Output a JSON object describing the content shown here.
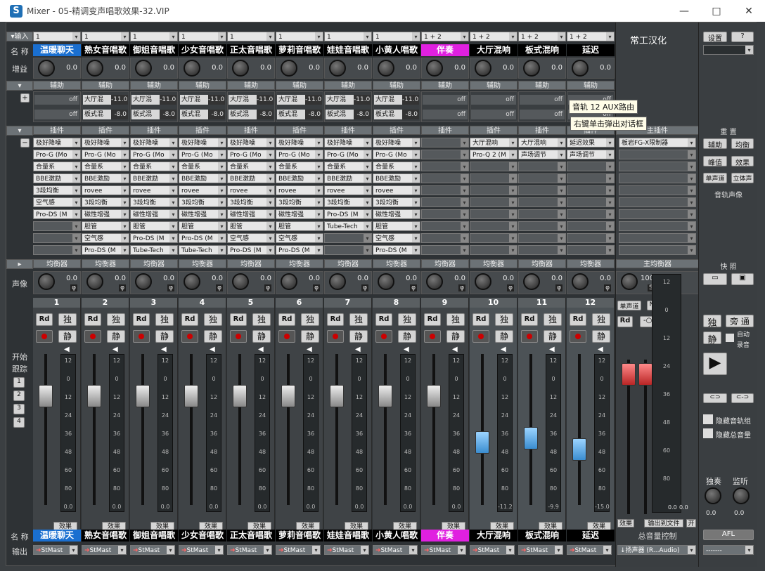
{
  "window": {
    "title": "Mixer - 05-精调变声唱歌效果-32.VIP",
    "icon_letter": "S"
  },
  "labels": {
    "input": "▾输入",
    "name": "名 称",
    "gain": "增益",
    "aux": "辅助",
    "plugin": "插件",
    "eq": "均衡器",
    "pan": "声像",
    "start": "开始",
    "follow": "跟踪",
    "name_bottom": "名 称",
    "output": "输出",
    "main_plugin": "主插件",
    "main_eq": "主均衡器",
    "reset": "重 置",
    "snapshot": "快 照",
    "track_pan": "音轨声像",
    "master_ctrl": "总音量控制",
    "hide_groups": "隐藏音轨组",
    "hide_master": "隐藏总音量",
    "solo": "独奏",
    "monitor": "监听",
    "afl": "AFL",
    "mono": "单声道",
    "n": "N",
    "output_to_file": "输出到文件",
    "open": "开",
    "auto": "自动",
    "record": "录音",
    "bypass": "旁 通",
    "solo_short": "独",
    "mute": "静",
    "rd": "Rd",
    "effect": "效果",
    "chinese": "常工汉化",
    "settings": "设置",
    "help": "?"
  },
  "follow_buttons": [
    "1",
    "2",
    "3",
    "4"
  ],
  "channels": [
    {
      "num": "1",
      "input": "1",
      "name": "温暖聊天",
      "color": "#1a6fd0",
      "gain": "0.0",
      "aux1": "off",
      "aux2": "off",
      "plugins": [
        "极好降噪",
        "Pro-G (Mo",
        "合量系",
        "BBE激励",
        "3段均衡",
        "空气感",
        "Pro-DS (M",
        "",
        "",
        ""
      ],
      "pan": "0.0",
      "meter": "0.0",
      "fader": 0.78,
      "cap": "gray"
    },
    {
      "num": "2",
      "input": "1",
      "name": "熟女音唱歌",
      "color": "#000000",
      "gain": "0.0",
      "aux1": "大厅混 -11.0",
      "aux2": "板式混 -8.0",
      "plugins": [
        "极好降噪",
        "Pro-G (Mo",
        "合量系",
        "BBE激励",
        "rovee",
        "3段均衡",
        "磁性增强",
        "胆管",
        "空气感",
        "Pro-DS (M"
      ],
      "pan": "0.0",
      "meter": "0.0",
      "fader": 0.78,
      "cap": "gray"
    },
    {
      "num": "3",
      "input": "1",
      "name": "御姐音唱歌",
      "color": "#000000",
      "gain": "0.0",
      "aux1": "大厅混 -11.0",
      "aux2": "板式混 -8.0",
      "plugins": [
        "极好降噪",
        "Pro-G (Mo",
        "合量系",
        "BBE激励",
        "rovee",
        "3段均衡",
        "磁性增强",
        "胆管",
        "Pro-DS (M",
        "Tube-Tech"
      ],
      "pan": "0.0",
      "meter": "0.0",
      "fader": 0.78,
      "cap": "gray"
    },
    {
      "num": "4",
      "input": "1",
      "name": "少女音唱歌",
      "color": "#000000",
      "gain": "0.0",
      "aux1": "大厅混 -11.0",
      "aux2": "板式混 -8.0",
      "plugins": [
        "极好降噪",
        "Pro-G (Mo",
        "合量系",
        "BBE激励",
        "rovee",
        "3段均衡",
        "磁性增强",
        "胆管",
        "Pro-DS (M",
        "Tube-Tech"
      ],
      "pan": "0.0",
      "meter": "0.0",
      "fader": 0.78,
      "cap": "gray"
    },
    {
      "num": "5",
      "input": "1",
      "name": "正太音唱歌",
      "color": "#000000",
      "gain": "0.0",
      "aux1": "大厅混 -11.0",
      "aux2": "板式混 -8.0",
      "plugins": [
        "极好降噪",
        "Pro-G (Mo",
        "合量系",
        "BBE激励",
        "rovee",
        "3段均衡",
        "磁性增强",
        "胆管",
        "空气感",
        "Pro-DS (M"
      ],
      "pan": "0.0",
      "meter": "0.0",
      "fader": 0.78,
      "cap": "gray"
    },
    {
      "num": "6",
      "input": "1",
      "name": "萝莉音唱歌",
      "color": "#000000",
      "gain": "0.0",
      "aux1": "大厅混 -11.0",
      "aux2": "板式混 -8.0",
      "plugins": [
        "极好降噪",
        "Pro-G (Mo",
        "合量系",
        "BBE激励",
        "rovee",
        "3段均衡",
        "磁性增强",
        "胆管",
        "空气感",
        "Pro-DS (M"
      ],
      "pan": "0.0",
      "meter": "0.0",
      "fader": 0.78,
      "cap": "gray"
    },
    {
      "num": "7",
      "input": "1",
      "name": "娃娃音唱歌",
      "color": "#000000",
      "gain": "0.0",
      "aux1": "大厅混 -11.0",
      "aux2": "板式混 -8.0",
      "plugins": [
        "极好降噪",
        "Pro-G (Mo",
        "合量系",
        "BBE激励",
        "rovee",
        "3段均衡",
        "Pro-DS (M",
        "Tube-Tech",
        "",
        ""
      ],
      "pan": "0.0",
      "meter": "0.0",
      "fader": 0.78,
      "cap": "gray"
    },
    {
      "num": "8",
      "input": "1",
      "name": "小黄人唱歌",
      "color": "#000000",
      "gain": "0.0",
      "aux1": "大厅混 -11.0",
      "aux2": "板式混 -8.0",
      "plugins": [
        "极好降噪",
        "Pro-G (Mo",
        "合量系",
        "BBE激励",
        "rovee",
        "3段均衡",
        "磁性增强",
        "胆管",
        "空气感",
        "Pro-DS (M"
      ],
      "pan": "0.0",
      "meter": "0.0",
      "fader": 0.78,
      "cap": "gray"
    },
    {
      "num": "9",
      "input": "1 + 2",
      "name": "伴奏",
      "color": "#e020e0",
      "gain": "0.0",
      "aux1": "off",
      "aux2": "off",
      "plugins": [
        "",
        "",
        "",
        "",
        "",
        "",
        "",
        "",
        "",
        ""
      ],
      "pan": "0.0",
      "meter": "0.0",
      "fader": 0.78,
      "cap": "gray"
    },
    {
      "num": "10",
      "input": "1 + 2",
      "name": "大厅混响",
      "color": "#000000",
      "gain": "0.0",
      "aux1": "off",
      "aux2": "off",
      "plugins": [
        "大厅混响",
        "Pro-Q 2 (M",
        "",
        "",
        "",
        "",
        "",
        "",
        "",
        ""
      ],
      "pan": "0.0",
      "meter": "-11.2",
      "fader": 0.45,
      "cap": "blue"
    },
    {
      "num": "11",
      "input": "1 + 2",
      "name": "板式混响",
      "color": "#000000",
      "gain": "0.0",
      "aux1": "off",
      "aux2": "off",
      "plugins": [
        "大厅混响",
        "声场调节",
        "",
        "",
        "",
        "",
        "",
        "",
        "",
        ""
      ],
      "pan": "0.0",
      "meter": "-9.9",
      "fader": 0.48,
      "cap": "blue"
    },
    {
      "num": "12",
      "input": "1 + 2",
      "name": "延迟",
      "color": "#000000",
      "gain": "0.0",
      "aux1": "off",
      "aux2": "off",
      "plugins": [
        "延迟效果",
        "声场调节",
        "",
        "",
        "",
        "",
        "",
        "",
        "",
        ""
      ],
      "pan": "0.0",
      "meter": "-15.0",
      "fader": 0.4,
      "cap": "blue"
    }
  ],
  "output_target": "StMast",
  "master": {
    "plugin": "板岩FG-X限制器",
    "pan": "100",
    "pan_suffix": "SE",
    "meter_left": "0.0",
    "meter_right": "0.0",
    "output": "扬声器 (R...Audio)",
    "output_prefix": "↓",
    "out2": "-------"
  },
  "meter_scale": [
    "12",
    "0",
    "12",
    "24",
    "36",
    "48",
    "60",
    "80"
  ],
  "master_scale": [
    "12",
    "0",
    "12",
    "24",
    "36",
    "48",
    "60",
    "80"
  ],
  "right_buttons": {
    "aux": "辅助",
    "eq": "均衡",
    "peak": "峰值",
    "effect": "效果",
    "mono": "单声道",
    "stereo": "立体声"
  },
  "tooltip": {
    "line1": "音轨 12 AUX路由",
    "line2": "右键单击弹出对话框"
  }
}
